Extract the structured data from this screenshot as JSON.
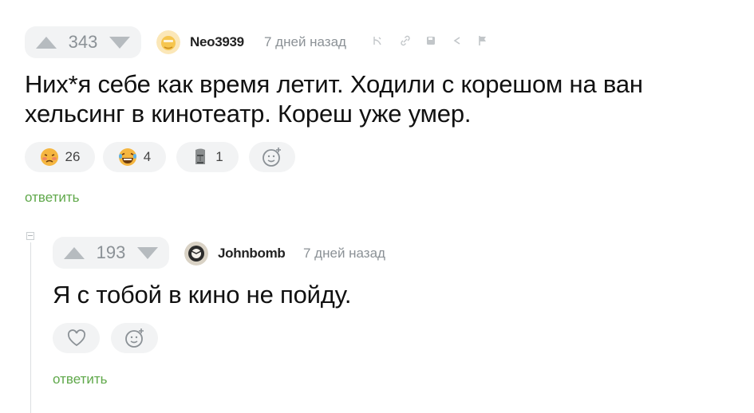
{
  "comment": {
    "rating": "343",
    "author": "Neo3939",
    "time": "7 дней назад",
    "text": "Них*я себе как время летит. Ходили с корешом на ван хельсинг в кинотеатр. Кореш уже умер.",
    "reactions": [
      {
        "icon": "sad-face-icon",
        "count": "26"
      },
      {
        "icon": "laughing-face-icon",
        "count": "4"
      },
      {
        "icon": "moai-icon",
        "count": "1"
      }
    ],
    "reply_label": "ответить"
  },
  "reply": {
    "rating": "193",
    "author": "Johnbomb",
    "time": "7 дней назад",
    "text": "Я с тобой в кино не пойду.",
    "reply_label": "ответить"
  },
  "colors": {
    "accent_green": "#5fa84a",
    "muted": "#8b9196",
    "pill_bg": "#f2f3f4"
  }
}
